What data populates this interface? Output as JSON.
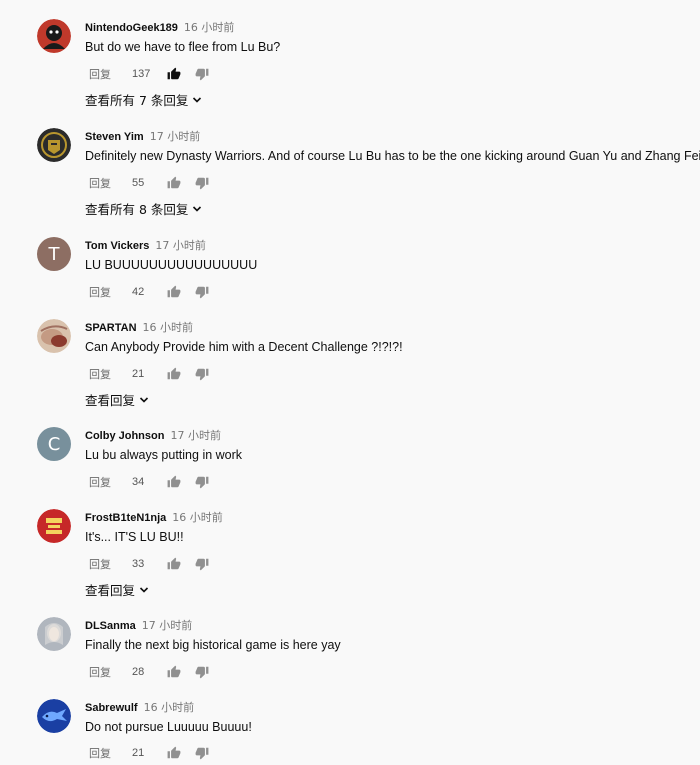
{
  "comments": [
    {
      "author": "NintendoGeek189",
      "time": "16 小时前",
      "text": "But do we have to flee from Lu Bu?",
      "reply_label": "回复",
      "likes": "137",
      "avatar_type": "image",
      "avatar_colors": [
        "#c0392b",
        "#1a1a1a"
      ],
      "liked": true,
      "view_replies": "查看所有 7 条回复"
    },
    {
      "author": "Steven Yim",
      "time": "17 小时前",
      "text": "Definitely new Dynasty Warriors. And of course Lu Bu has to be the one kicking around Guan Yu and Zhang Fei.",
      "reply_label": "回复",
      "likes": "55",
      "avatar_type": "image",
      "avatar_colors": [
        "#2b2b2b",
        "#b8962e"
      ],
      "liked": false,
      "view_replies": "查看所有 8 条回复"
    },
    {
      "author": "Tom Vickers",
      "time": "17 小时前",
      "text": "LU BUUUUUUUUUUUUUUUU",
      "reply_label": "回复",
      "likes": "42",
      "avatar_type": "letter",
      "avatar_letter": "T",
      "avatar_colors": [
        "#8d6e63"
      ],
      "liked": false
    },
    {
      "author": "SPARTAN",
      "time": "16 小时前",
      "text": "Can Anybody Provide him with a Decent Challenge ?!?!?!",
      "reply_label": "回复",
      "likes": "21",
      "avatar_type": "image",
      "avatar_colors": [
        "#d9c2ad",
        "#8b3a2e"
      ],
      "liked": false,
      "view_replies": "查看回复"
    },
    {
      "author": "Colby Johnson",
      "time": "17 小时前",
      "text": "Lu bu always putting in work",
      "reply_label": "回复",
      "likes": "34",
      "avatar_type": "letter",
      "avatar_letter": "C",
      "avatar_colors": [
        "#78909c"
      ],
      "liked": false
    },
    {
      "author": "FrostB1teN1nja",
      "time": "16 小时前",
      "text": "It's... IT'S LU BU!!",
      "reply_label": "回复",
      "likes": "33",
      "avatar_type": "image",
      "avatar_colors": [
        "#c62828",
        "#f4d35e"
      ],
      "liked": false,
      "view_replies": "查看回复"
    },
    {
      "author": "DLSanma",
      "time": "17 小时前",
      "text": "Finally the next big historical game is here yay",
      "reply_label": "回复",
      "likes": "28",
      "avatar_type": "image",
      "avatar_colors": [
        "#b0b6be",
        "#e9e4de"
      ],
      "liked": false
    },
    {
      "author": "Sabrewulf",
      "time": "16 小时前",
      "text": "Do not pursue Luuuuu Buuuu!",
      "reply_label": "回复",
      "likes": "21",
      "avatar_type": "image",
      "avatar_colors": [
        "#1a3fa3",
        "#6fa8ff"
      ],
      "liked": false
    }
  ],
  "icons": {
    "like": "thumb-up-icon",
    "dislike": "thumb-down-icon",
    "expand": "chevron-down-icon"
  },
  "colors": {
    "background": "#f9f9f9",
    "icon_gray": "#909090",
    "icon_dark": "#0f0f0f"
  }
}
